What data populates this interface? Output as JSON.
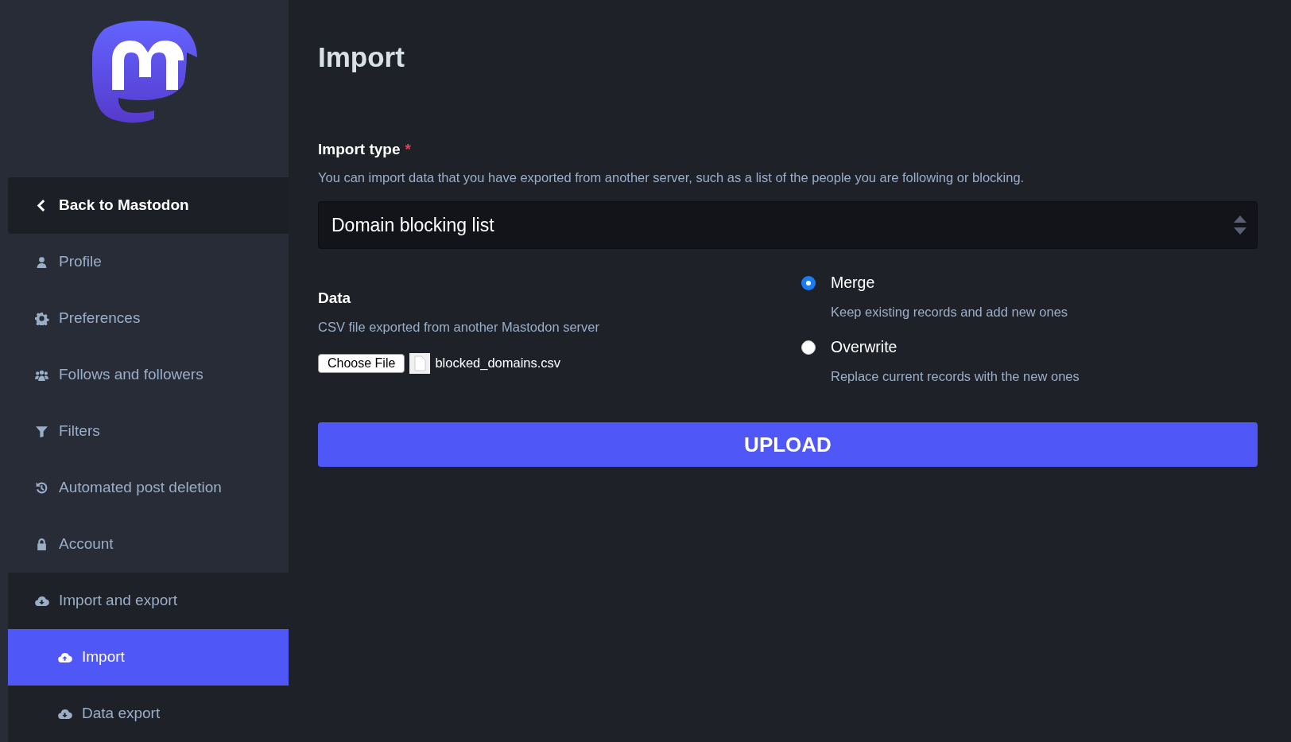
{
  "sidebar": {
    "back": {
      "label": "Back to Mastodon"
    },
    "items": [
      {
        "label": "Profile",
        "selected": false
      },
      {
        "label": "Preferences",
        "selected": false
      },
      {
        "label": "Follows and followers",
        "selected": false
      },
      {
        "label": "Filters",
        "selected": false
      },
      {
        "label": "Automated post deletion",
        "selected": false
      },
      {
        "label": "Account",
        "selected": false
      },
      {
        "label": "Import and export",
        "selected": false,
        "expanded": true,
        "children": [
          {
            "label": "Import",
            "selected": true
          },
          {
            "label": "Data export",
            "selected": false
          }
        ]
      }
    ]
  },
  "page": {
    "title": "Import",
    "import_type": {
      "label": "Import type",
      "required_mark": "*",
      "hint": "You can import data that you have exported from another server, such as a list of the people you are following or blocking.",
      "value": "Domain blocking list"
    },
    "data": {
      "label": "Data",
      "hint": "CSV file exported from another Mastodon server",
      "button": "Choose File",
      "file_name": "blocked_domains.csv"
    },
    "modes": [
      {
        "label": "Merge",
        "hint": "Keep existing records and add new ones",
        "selected": true
      },
      {
        "label": "Overwrite",
        "hint": "Replace current records with the new ones",
        "selected": false
      }
    ],
    "submit": "UPLOAD"
  }
}
